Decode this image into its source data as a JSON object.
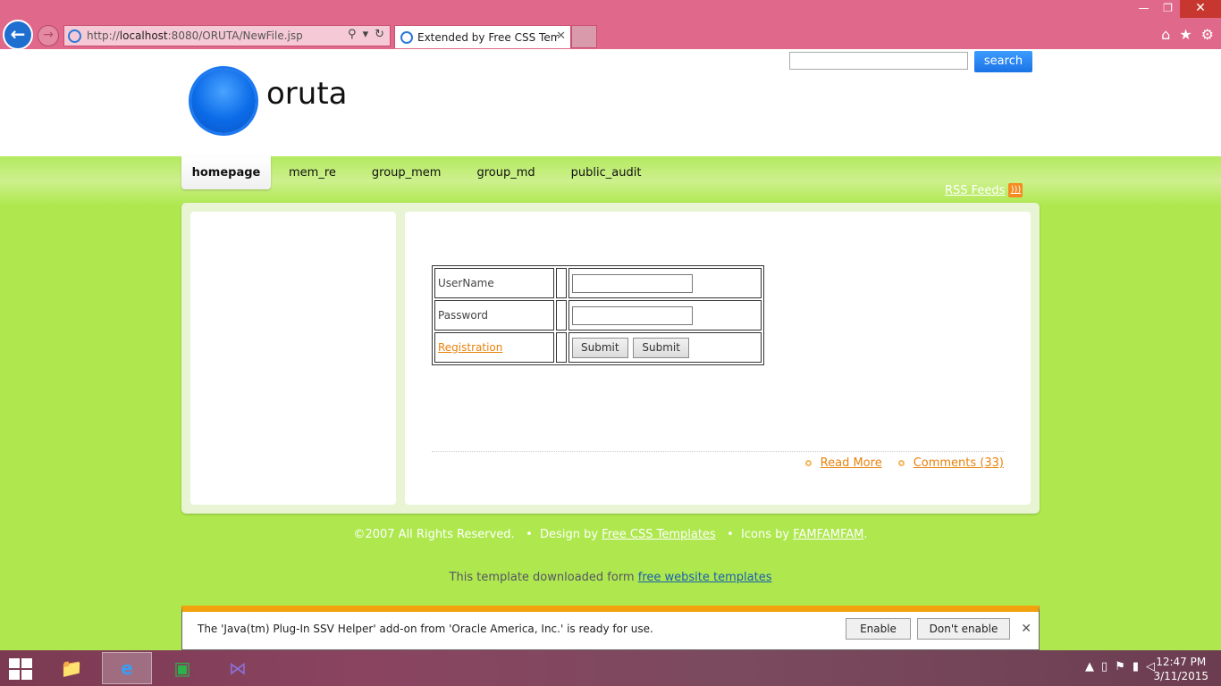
{
  "browser": {
    "url_prefix": "http://",
    "url_host": "localhost",
    "url_path": ":8080/ORUTA/NewFile.jsp",
    "tab_title": "Extended by Free CSS Temp..."
  },
  "header": {
    "site_title": "oruta",
    "search_button": "search"
  },
  "nav": {
    "items": [
      "homepage",
      "mem_re",
      "group_mem",
      "group_md",
      "public_audit"
    ],
    "rss_label": "RSS Feeds"
  },
  "login": {
    "username_label": "UserName",
    "password_label": "Password",
    "registration_link": "Registration",
    "submit1": "Submit",
    "submit2": "Submit"
  },
  "post_links": {
    "read_more": "Read More",
    "comments": "Comments (33)"
  },
  "footer": {
    "copyright": "©2007 All Rights Reserved.",
    "design_by": "Design by",
    "design_link": "Free CSS Templates",
    "icons_by": "Icons by",
    "icons_link": "FAMFAMFAM",
    "download_note": "This template downloaded form",
    "download_link": "free website templates"
  },
  "notification": {
    "message": "The 'Java(tm) Plug-In SSV Helper' add-on from 'Oracle America, Inc.' is ready for use.",
    "enable": "Enable",
    "dont_enable": "Don't enable"
  },
  "taskbar": {
    "time": "12:47 PM",
    "date": "3/11/2015"
  },
  "colors": {
    "page_green": "#aee84e",
    "browser_chrome": "#e0688a",
    "link_orange": "#e8820c",
    "logo_blue": "#0b6be8"
  }
}
